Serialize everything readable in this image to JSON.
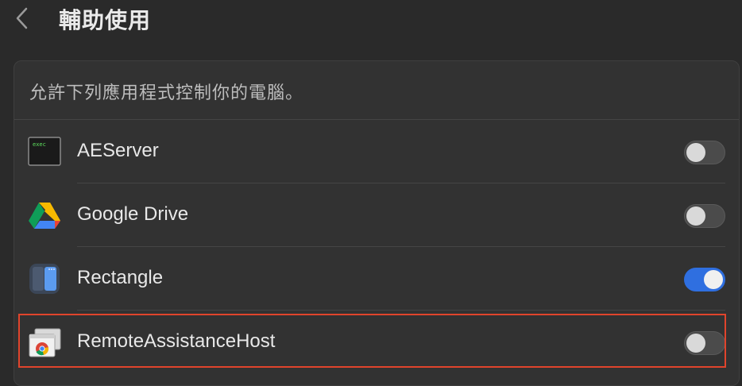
{
  "header": {
    "back_icon": "chevron-left-icon",
    "title": "輔助使用"
  },
  "panel": {
    "description": "允許下列應用程式控制你的電腦。",
    "apps": [
      {
        "name": "AEServer",
        "icon": "terminal-exec-icon",
        "icon_text": "exec",
        "enabled": false
      },
      {
        "name": "Google Drive",
        "icon": "google-drive-icon",
        "enabled": false
      },
      {
        "name": "Rectangle",
        "icon": "rectangle-app-icon",
        "enabled": true
      },
      {
        "name": "RemoteAssistanceHost",
        "icon": "remote-assistance-chrome-icon",
        "enabled": false
      }
    ]
  },
  "colors": {
    "toggle_on": "#2f6fe0",
    "highlight": "#e0442c"
  }
}
